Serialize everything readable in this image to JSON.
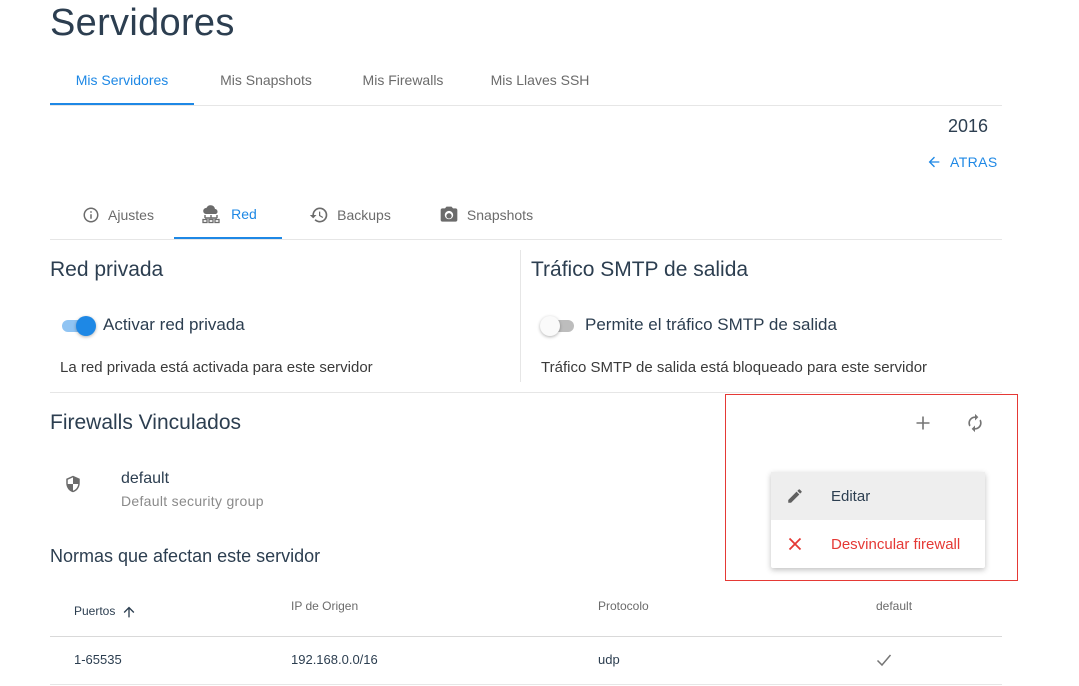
{
  "page": {
    "title": "Servidores"
  },
  "main_tabs": [
    {
      "label": "Mis Servidores",
      "active": true
    },
    {
      "label": "Mis Snapshots",
      "active": false
    },
    {
      "label": "Mis Firewalls",
      "active": false
    },
    {
      "label": "Mis Llaves SSH",
      "active": false
    }
  ],
  "server": {
    "id": "2016",
    "back_label": "ATRAS"
  },
  "sub_tabs": [
    {
      "label": "Ajustes",
      "icon": "info-icon",
      "active": false
    },
    {
      "label": "Red",
      "icon": "cloud-network-icon",
      "active": true
    },
    {
      "label": "Backups",
      "icon": "history-icon",
      "active": false
    },
    {
      "label": "Snapshots",
      "icon": "camera-icon",
      "active": false
    }
  ],
  "private_network": {
    "title": "Red privada",
    "toggle_label": "Activar red privada",
    "enabled": true,
    "description": "La red privada está activada para este servidor"
  },
  "smtp": {
    "title": "Tráfico SMTP de salida",
    "toggle_label": "Permite el tráfico SMTP de salida",
    "enabled": false,
    "description": "Tráfico SMTP de salida está bloqueado para este servidor"
  },
  "firewalls": {
    "title": "Firewalls Vinculados",
    "items": [
      {
        "name": "default",
        "description": "Default security group",
        "icon": "shield-icon"
      }
    ],
    "menu": [
      {
        "label": "Editar",
        "icon": "pencil-icon"
      },
      {
        "label": "Desvincular firewall",
        "icon": "close-icon"
      }
    ]
  },
  "rules": {
    "title": "Normas que afectan este servidor",
    "columns": [
      "Puertos",
      "IP de Origen",
      "Protocolo",
      "default"
    ],
    "rows": [
      {
        "ports": "1-65535",
        "source_ip": "192.168.0.0/16",
        "protocol": "udp",
        "default": true
      }
    ]
  },
  "colors": {
    "accent": "#1e88e5",
    "danger": "#e53935",
    "text": "#2c3e50"
  }
}
